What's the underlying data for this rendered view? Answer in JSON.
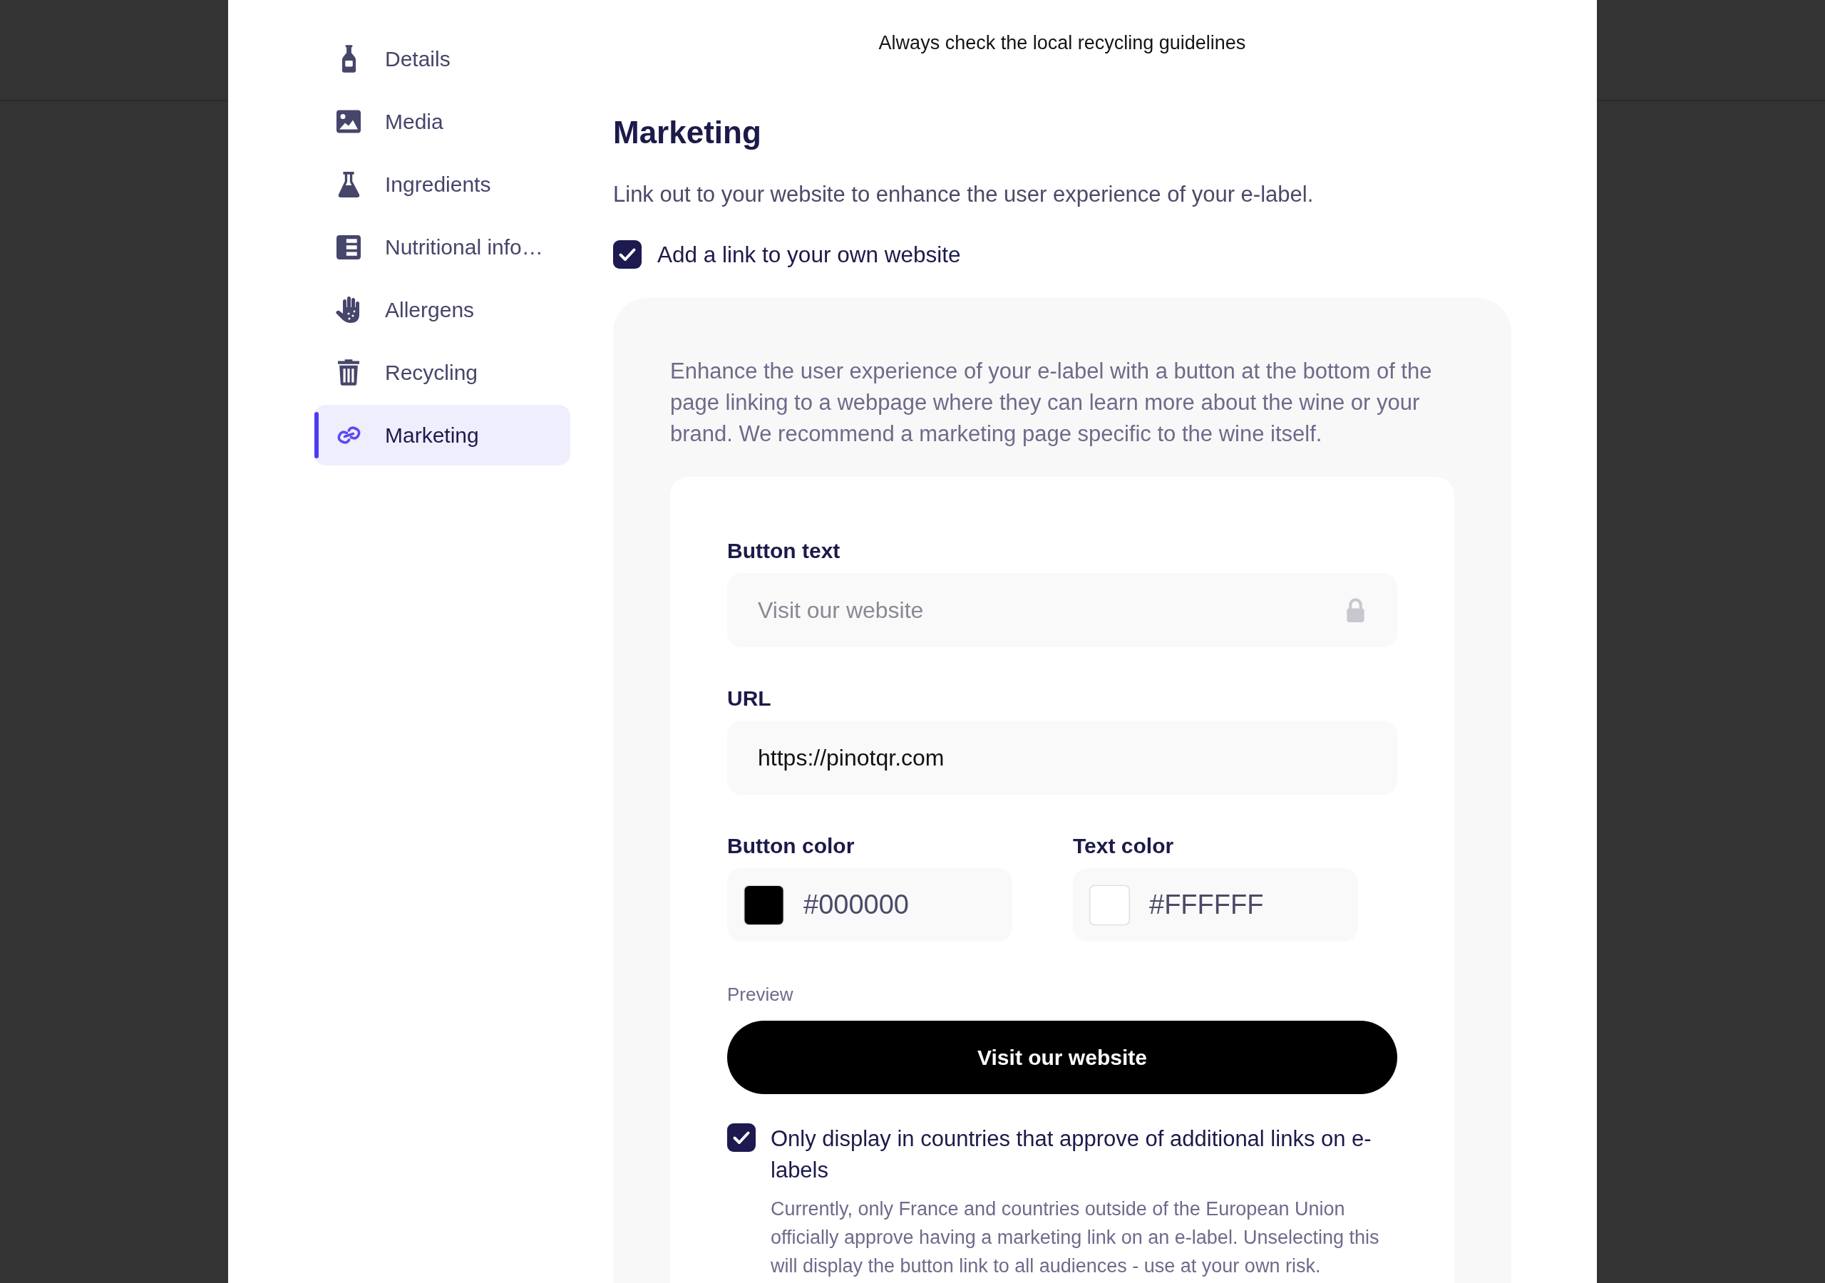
{
  "notice": "Always check the local recycling guidelines",
  "sidebar": {
    "items": [
      {
        "label": "Details",
        "selected": false
      },
      {
        "label": "Media",
        "selected": false
      },
      {
        "label": "Ingredients",
        "selected": false
      },
      {
        "label": "Nutritional info…",
        "selected": false
      },
      {
        "label": "Allergens",
        "selected": false
      },
      {
        "label": "Recycling",
        "selected": false
      },
      {
        "label": "Marketing",
        "selected": true
      }
    ]
  },
  "section": {
    "title": "Marketing",
    "description": "Link out to your website to enhance the user experience of your e-label.",
    "website_link": {
      "label": "Add a link to your own website",
      "checked": true
    },
    "panel": {
      "description": "Enhance the user experience of your e-label with a button at the bottom of the page linking to a webpage where they can learn more about the wine or your brand. We recommend a marketing page specific to the wine itself.",
      "button_text": {
        "label": "Button text",
        "value": "Visit our website",
        "disabled": true
      },
      "url": {
        "label": "URL",
        "value": "https://pinotqr.com"
      },
      "colors": [
        {
          "label": "Button color",
          "value": "#000000"
        },
        {
          "label": "Text color",
          "value": "#FFFFFF"
        }
      ],
      "preview": {
        "label": "Preview",
        "button": "Visit our website"
      },
      "country_restriction": {
        "label": "Only display in countries that approve of additional links on e-labels",
        "checked": true,
        "help": "Currently, only France and countries outside of the European Union officially approve having a marketing link on an e-label. Unselecting this will display the button link to all audiences - use at your own risk."
      }
    }
  }
}
